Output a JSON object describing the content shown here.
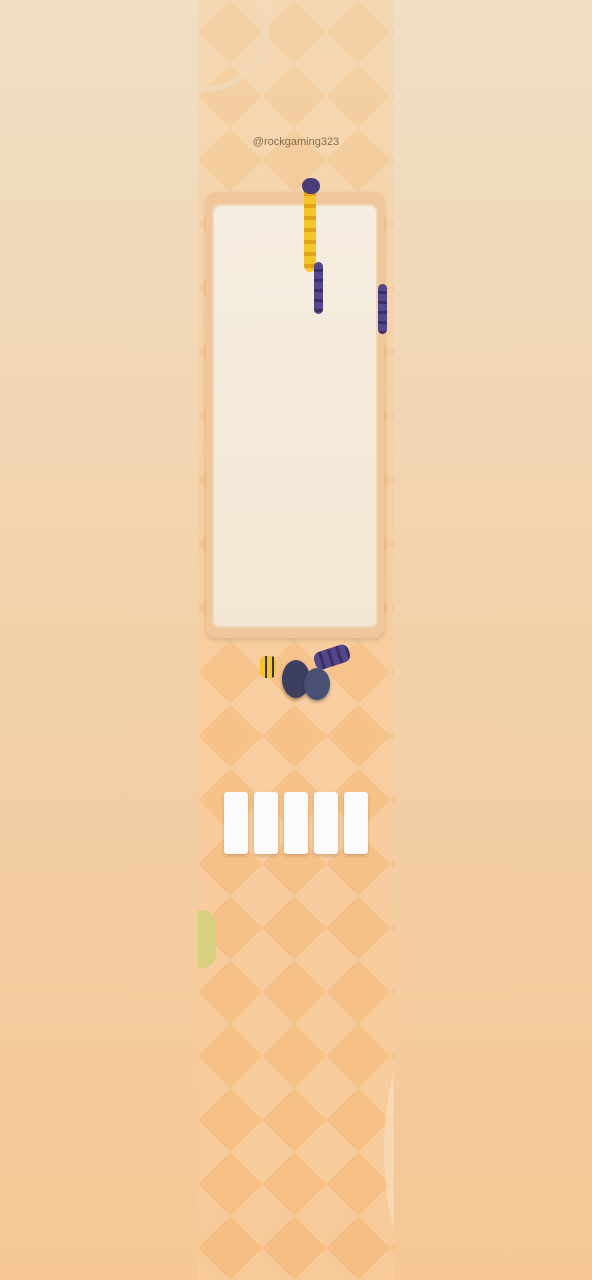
{
  "game": {
    "username": "@rockgaming323",
    "status_text": "",
    "slots": [
      {
        "state": "empty"
      },
      {
        "state": "empty"
      },
      {
        "state": "empty"
      },
      {
        "state": "empty"
      },
      {
        "state": "empty"
      }
    ],
    "colors": {
      "background": "#f6c58d",
      "board": "#f4ead9",
      "board_frame": "#f0c79a",
      "worm_yellow": "#f2c02a",
      "worm_purple": "#4b3d78",
      "chip": "#3d3f5f",
      "slot": "#fbfbfb",
      "leaf": "#d8d27e"
    }
  }
}
